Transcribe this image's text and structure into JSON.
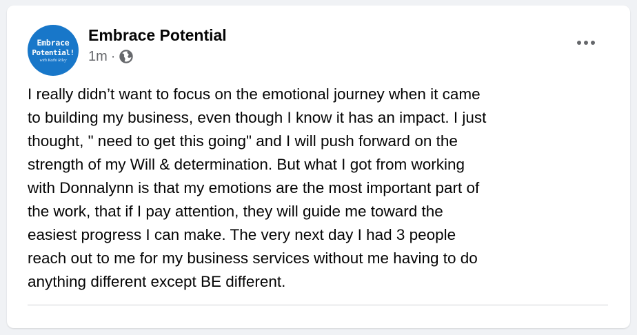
{
  "post": {
    "avatar": {
      "line1": "Embrace",
      "line2": "Potential!",
      "line3": "with Kathi Riley"
    },
    "page_name": "Embrace Potential",
    "timestamp": "1m",
    "separator": "·",
    "privacy_icon": "globe-icon",
    "more_icon": "more-options-icon",
    "text": "I really didn’t want to focus on the emotional journey when it came\nto building my business, even though I know it has an impact. I just\nthought, \" need to get this going\" and I will push forward on the\nstrength of my Will & determination. But what I got from working\nwith Donnalynn is that my emotions are the most important part of\nthe work, that if I pay attention, they will guide me toward the\neasiest progress I can make. The very next day I had 3 people\nreach out to me for my business services without me having to do\nanything different except BE different."
  },
  "colors": {
    "background": "#f0f2f5",
    "card": "#ffffff",
    "avatar": "#1877c9",
    "primary_text": "#050505",
    "secondary_text": "#65676b",
    "divider": "#ced0d4"
  }
}
